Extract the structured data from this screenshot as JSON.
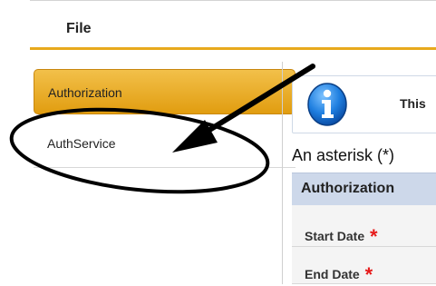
{
  "menu": {
    "file_label": "File"
  },
  "sidebar": {
    "items": [
      {
        "label": "Authorization",
        "active": true
      },
      {
        "label": "AuthService",
        "active": false
      }
    ]
  },
  "info": {
    "text": "This",
    "icon": "info-icon"
  },
  "form": {
    "note": "An asterisk (*)",
    "section_header": "Authorization",
    "fields": [
      {
        "label": "Start Date",
        "required_mark": "*"
      },
      {
        "label": "End Date",
        "required_mark": "*"
      }
    ]
  },
  "colors": {
    "accent": "#e8a91c",
    "required": "#e61b1b",
    "header_bg": "#cdd8ea"
  }
}
